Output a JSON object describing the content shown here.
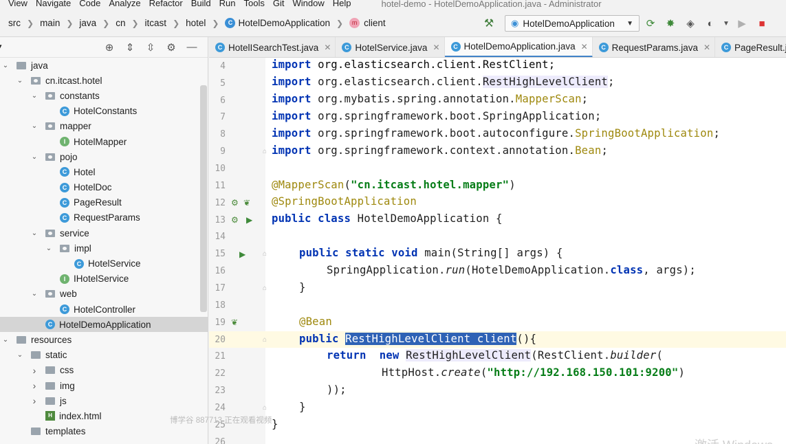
{
  "menu": {
    "items": [
      "View",
      "Navigate",
      "Code",
      "Analyze",
      "Refactor",
      "Build",
      "Run",
      "Tools",
      "Git",
      "Window",
      "Help"
    ],
    "window_title": "hotel-demo - HotelDemoApplication.java - Administrator"
  },
  "breadcrumbs": [
    "src",
    "main",
    "java",
    "cn",
    "itcast",
    "hotel",
    "HotelDemoApplication",
    "client"
  ],
  "run_config": {
    "label": "HotelDemoApplication"
  },
  "project_panel": {
    "rows": [
      {
        "label": "java",
        "kind": "folder",
        "depth": 0,
        "arrow": "down"
      },
      {
        "label": "cn.itcast.hotel",
        "kind": "package",
        "depth": 1,
        "arrow": "down"
      },
      {
        "label": "constants",
        "kind": "package",
        "depth": 2,
        "arrow": "down"
      },
      {
        "label": "HotelConstants",
        "kind": "class",
        "depth": 3,
        "arrow": ""
      },
      {
        "label": "mapper",
        "kind": "package",
        "depth": 2,
        "arrow": "down"
      },
      {
        "label": "HotelMapper",
        "kind": "interface",
        "depth": 3,
        "arrow": ""
      },
      {
        "label": "pojo",
        "kind": "package",
        "depth": 2,
        "arrow": "down"
      },
      {
        "label": "Hotel",
        "kind": "class",
        "depth": 3,
        "arrow": ""
      },
      {
        "label": "HotelDoc",
        "kind": "class",
        "depth": 3,
        "arrow": ""
      },
      {
        "label": "PageResult",
        "kind": "class",
        "depth": 3,
        "arrow": ""
      },
      {
        "label": "RequestParams",
        "kind": "class",
        "depth": 3,
        "arrow": ""
      },
      {
        "label": "service",
        "kind": "package",
        "depth": 2,
        "arrow": "down"
      },
      {
        "label": "impl",
        "kind": "package",
        "depth": 3,
        "arrow": "down"
      },
      {
        "label": "HotelService",
        "kind": "class",
        "depth": 4,
        "arrow": ""
      },
      {
        "label": "IHotelService",
        "kind": "interface",
        "depth": 3,
        "arrow": ""
      },
      {
        "label": "web",
        "kind": "package",
        "depth": 2,
        "arrow": "down"
      },
      {
        "label": "HotelController",
        "kind": "class",
        "depth": 3,
        "arrow": ""
      },
      {
        "label": "HotelDemoApplication",
        "kind": "class",
        "depth": 2,
        "arrow": "",
        "selected": true
      },
      {
        "label": "resources",
        "kind": "folder",
        "depth": 0,
        "arrow": "down"
      },
      {
        "label": "static",
        "kind": "folder",
        "depth": 1,
        "arrow": "down"
      },
      {
        "label": "css",
        "kind": "folder",
        "depth": 2,
        "arrow": "right"
      },
      {
        "label": "img",
        "kind": "folder",
        "depth": 2,
        "arrow": "right"
      },
      {
        "label": "js",
        "kind": "folder",
        "depth": 2,
        "arrow": "right"
      },
      {
        "label": "index.html",
        "kind": "html",
        "depth": 2,
        "arrow": ""
      },
      {
        "label": "templates",
        "kind": "folder",
        "depth": 1,
        "arrow": ""
      }
    ]
  },
  "tabs": [
    {
      "label": "HotelISearchTest.java",
      "active": false
    },
    {
      "label": "HotelService.java",
      "active": false
    },
    {
      "label": "HotelDemoApplication.java",
      "active": true
    },
    {
      "label": "RequestParams.java",
      "active": false
    },
    {
      "label": "PageResult.java",
      "active": false
    }
  ],
  "editor": {
    "lines": [
      {
        "n": "4"
      },
      {
        "n": "5"
      },
      {
        "n": "6"
      },
      {
        "n": "7"
      },
      {
        "n": "8"
      },
      {
        "n": "9"
      },
      {
        "n": "10"
      },
      {
        "n": "11"
      },
      {
        "n": "12"
      },
      {
        "n": "13"
      },
      {
        "n": "14"
      },
      {
        "n": "15"
      },
      {
        "n": "16"
      },
      {
        "n": "17"
      },
      {
        "n": "18"
      },
      {
        "n": "19"
      },
      {
        "n": "20"
      },
      {
        "n": "21"
      },
      {
        "n": "22"
      },
      {
        "n": "23"
      },
      {
        "n": "24"
      },
      {
        "n": "25"
      },
      {
        "n": "26"
      }
    ],
    "current_line": "20",
    "code": {
      "l4": {
        "kw": "import",
        "rest": "org.elasticsearch.client.RestClient;"
      },
      "l5": {
        "kw": "import",
        "pre": "org.elasticsearch.client.",
        "hl": "RestHighLevelClient",
        "post": ";"
      },
      "l6": {
        "kw": "import",
        "pre": "org.mybatis.spring.annotation.",
        "ann": "MapperScan",
        "post": ";"
      },
      "l7": {
        "kw": "import",
        "rest": "org.springframework.boot.SpringApplication;"
      },
      "l8": {
        "kw": "import",
        "pre": "org.springframework.boot.autoconfigure.",
        "ann": "SpringBootApplication",
        "post": ";"
      },
      "l9": {
        "kw": "import",
        "pre": "org.springframework.context.annotation.",
        "ann": "Bean",
        "post": ";"
      },
      "l11": {
        "ann": "@MapperScan",
        "open": "(",
        "str": "\"cn.itcast.hotel.mapper\"",
        "close": ")"
      },
      "l12": {
        "ann": "@SpringBootApplication"
      },
      "l13": {
        "kw1": "public",
        "kw2": "class",
        "rest": "HotelDemoApplication {"
      },
      "l15": {
        "kw1": "public",
        "kw2": "static",
        "kw3": "void",
        "rest": "main(String[] args) {"
      },
      "l16": {
        "pre": "SpringApplication.",
        "it": "run",
        "mid": "(HotelDemoApplication.",
        "kw": "class",
        "post": ", args);"
      },
      "l17": {
        "text": "}"
      },
      "l19": {
        "ann": "@Bean"
      },
      "l20": {
        "kw": "public",
        "sel": "RestHighLevelClient client",
        "post": "(){"
      },
      "l21": {
        "kw1": "return",
        "kw2": "new",
        "hl": "RestHighLevelClient",
        "pre": "(RestClient.",
        "it": "builder",
        "post": "("
      },
      "l22": {
        "pre": "HttpHost.",
        "it": "create",
        "open": "(",
        "str": "\"http://192.168.150.101:9200\"",
        "close": ")"
      },
      "l23": {
        "text": "));"
      },
      "l24": {
        "text": "}"
      },
      "l25": {
        "text": "}"
      }
    }
  },
  "overlay": {
    "watermark": "博学谷 887713 正在观看视频",
    "activate": "激活 Windows"
  }
}
